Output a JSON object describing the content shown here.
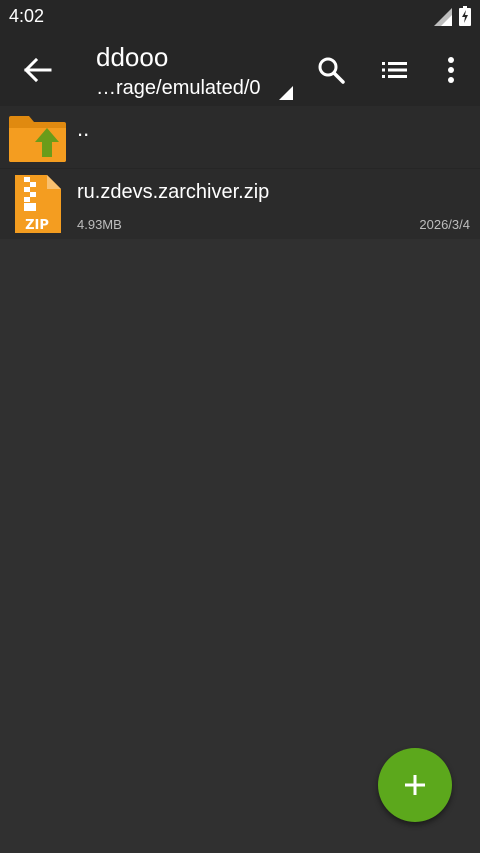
{
  "status_bar": {
    "time": "4:02"
  },
  "toolbar": {
    "title": "ddooo",
    "path": "…rage/emulated/0"
  },
  "files": {
    "parent_label": "..",
    "items": [
      {
        "name": "ru.zdevs.zarchiver.zip",
        "size": "4.93MB",
        "date": "2026/3/4",
        "icon": "zip-icon",
        "icon_label": "ZIP"
      }
    ]
  },
  "colors": {
    "background": "#303030",
    "toolbar": "#262626",
    "row": "#2b2b2b",
    "fab": "#5ca81c",
    "folder": "#f49d20",
    "up_arrow": "#6a9c1a"
  }
}
